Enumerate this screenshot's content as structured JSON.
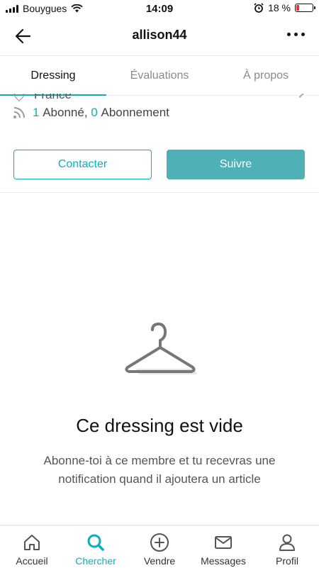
{
  "status_bar": {
    "carrier": "Bouygues",
    "time": "14:09",
    "battery": "18 %",
    "battery_level": 0.18
  },
  "nav": {
    "title": "allison44"
  },
  "tabs": [
    {
      "label": "Dressing",
      "active": true
    },
    {
      "label": "Évaluations",
      "active": false
    },
    {
      "label": "À propos",
      "active": false
    }
  ],
  "profile": {
    "location": "France",
    "followers_count": "1",
    "followers_label": "Abonné,",
    "following_count": "0",
    "following_label": "Abonnement"
  },
  "actions": {
    "contact_label": "Contacter",
    "follow_label": "Suivre"
  },
  "empty_state": {
    "title": "Ce dressing est vide",
    "text": "Abonne-toi à ce membre et tu recevras une notification quand il ajoutera un article"
  },
  "tabbar": [
    {
      "label": "Accueil",
      "icon": "home-icon",
      "active": false
    },
    {
      "label": "Chercher",
      "icon": "search-icon",
      "active": true
    },
    {
      "label": "Vendre",
      "icon": "plus-circle-icon",
      "active": false
    },
    {
      "label": "Messages",
      "icon": "mail-icon",
      "active": false
    },
    {
      "label": "Profil",
      "icon": "user-icon",
      "active": false
    }
  ],
  "colors": {
    "accent": "#09b1ba",
    "follow_button": "#4fb0b6",
    "battery_low": "#e8333a"
  }
}
